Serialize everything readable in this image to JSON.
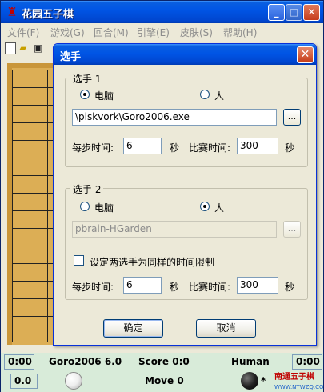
{
  "window": {
    "title": "花园五子棋",
    "title_icon": "gomoku-app-icon",
    "minimize": "_",
    "maximize": "□",
    "close": "✕"
  },
  "menu": [
    {
      "label": "文件(F)"
    },
    {
      "label": "游戏(G)"
    },
    {
      "label": "回合(M)"
    },
    {
      "label": "引擎(E)"
    },
    {
      "label": "皮肤(S)"
    },
    {
      "label": "帮助(H)"
    }
  ],
  "toolbar": {
    "icons": [
      "new-file-icon",
      "open-folder-icon",
      "save-disk-icon"
    ]
  },
  "dialog": {
    "title": "选手",
    "close": "✕",
    "player1": {
      "legend": "选手 1",
      "radio_computer": "电脑",
      "radio_human": "人",
      "selected": "computer",
      "engine_path": "\\piskvork\\Goro2006.exe",
      "browse": "...",
      "step_time_label": "每步时间:",
      "step_time_value": "6",
      "step_time_unit": "秒",
      "match_time_label": "比赛时间:",
      "match_time_value": "300",
      "match_time_unit": "秒"
    },
    "player2": {
      "legend": "选手 2",
      "radio_computer": "电脑",
      "radio_human": "人",
      "selected": "human",
      "engine_path": "pbrain-HGarden",
      "browse": "...",
      "same_limit_label": "设定两选手为同样的时间限制",
      "same_limit_checked": false,
      "step_time_label": "每步时间:",
      "step_time_value": "6",
      "step_time_unit": "秒",
      "match_time_label": "比赛时间:",
      "match_time_value": "300",
      "match_time_unit": "秒"
    },
    "ok": "确定",
    "cancel": "取消"
  },
  "status": {
    "left_time": "0:00",
    "left_player": "Goro2006 6.0",
    "score": "Score 0:0",
    "right_player": "Human",
    "right_time": "0:00",
    "left_step": "0.0",
    "move": "Move 0",
    "turn_marker": "*",
    "logo_text": "南通五子棋",
    "logo_sub": "WWW.NTWZQ.COM"
  }
}
